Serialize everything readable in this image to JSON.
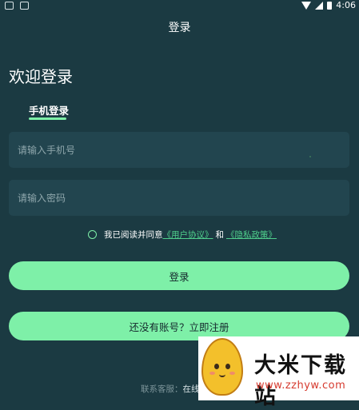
{
  "status_bar": {
    "time": "4:06",
    "left_icons": [
      "notification-icon",
      "image-icon"
    ],
    "right_icons": [
      "wifi-icon",
      "signal-icon",
      "battery-icon"
    ]
  },
  "appbar": {
    "title": "登录"
  },
  "welcome": "欢迎登录",
  "tabs": [
    {
      "label": "手机登录",
      "active": true
    }
  ],
  "form": {
    "phone_placeholder": "请输入手机号",
    "password_placeholder": "请输入密码"
  },
  "agreement": {
    "prefix": "我已阅读并同意",
    "user_agreement": "《用户协议》",
    "and": "和",
    "privacy_policy": "《隐私政策》"
  },
  "buttons": {
    "login": "登录",
    "register": "还没有账号？立即注册"
  },
  "footer": {
    "service_label": "联系客服：",
    "service_value": "在线"
  },
  "watermark": {
    "title": "大米下载站",
    "url": "www.zzhyw.com"
  },
  "colors": {
    "background": "#1b3a42",
    "field": "#22454f",
    "accent": "#7ef0a8",
    "link": "#4fcf8c"
  }
}
